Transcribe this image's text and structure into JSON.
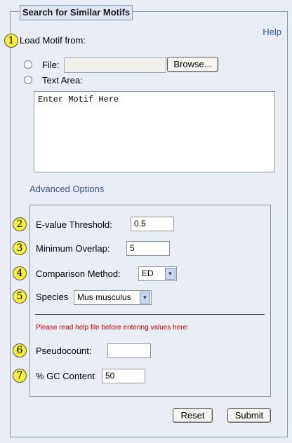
{
  "legend": "Search for Similar Motifs",
  "help": "Help",
  "load": {
    "badge": "1",
    "label": "Load Motif from:",
    "file_label": "File:",
    "browse": "Browse...",
    "textarea_label": "Text Area:",
    "textarea_value": "Enter Motif Here"
  },
  "advanced": {
    "title": "Advanced Options",
    "evalue": {
      "badge": "2",
      "label": "E-value Threshold:",
      "value": "0.5"
    },
    "overlap": {
      "badge": "3",
      "label": "Minimum Overlap:",
      "value": "5"
    },
    "method": {
      "badge": "4",
      "label": "Comparison Method:",
      "value": "ED"
    },
    "species": {
      "badge": "5",
      "label": "Species",
      "value": "Mus musculus"
    },
    "warning": "Please read help file before entering values here:",
    "pseudocount": {
      "badge": "6",
      "label": "Pseudocount:",
      "value": ""
    },
    "gc": {
      "badge": "7",
      "label": "% GC Content",
      "value": "50"
    }
  },
  "buttons": {
    "reset": "Reset",
    "submit": "Submit"
  },
  "colors": {
    "badge": "#f7ee3a",
    "link": "#2a5aa0",
    "warning": "#c00000",
    "background": "#e9eef6"
  }
}
